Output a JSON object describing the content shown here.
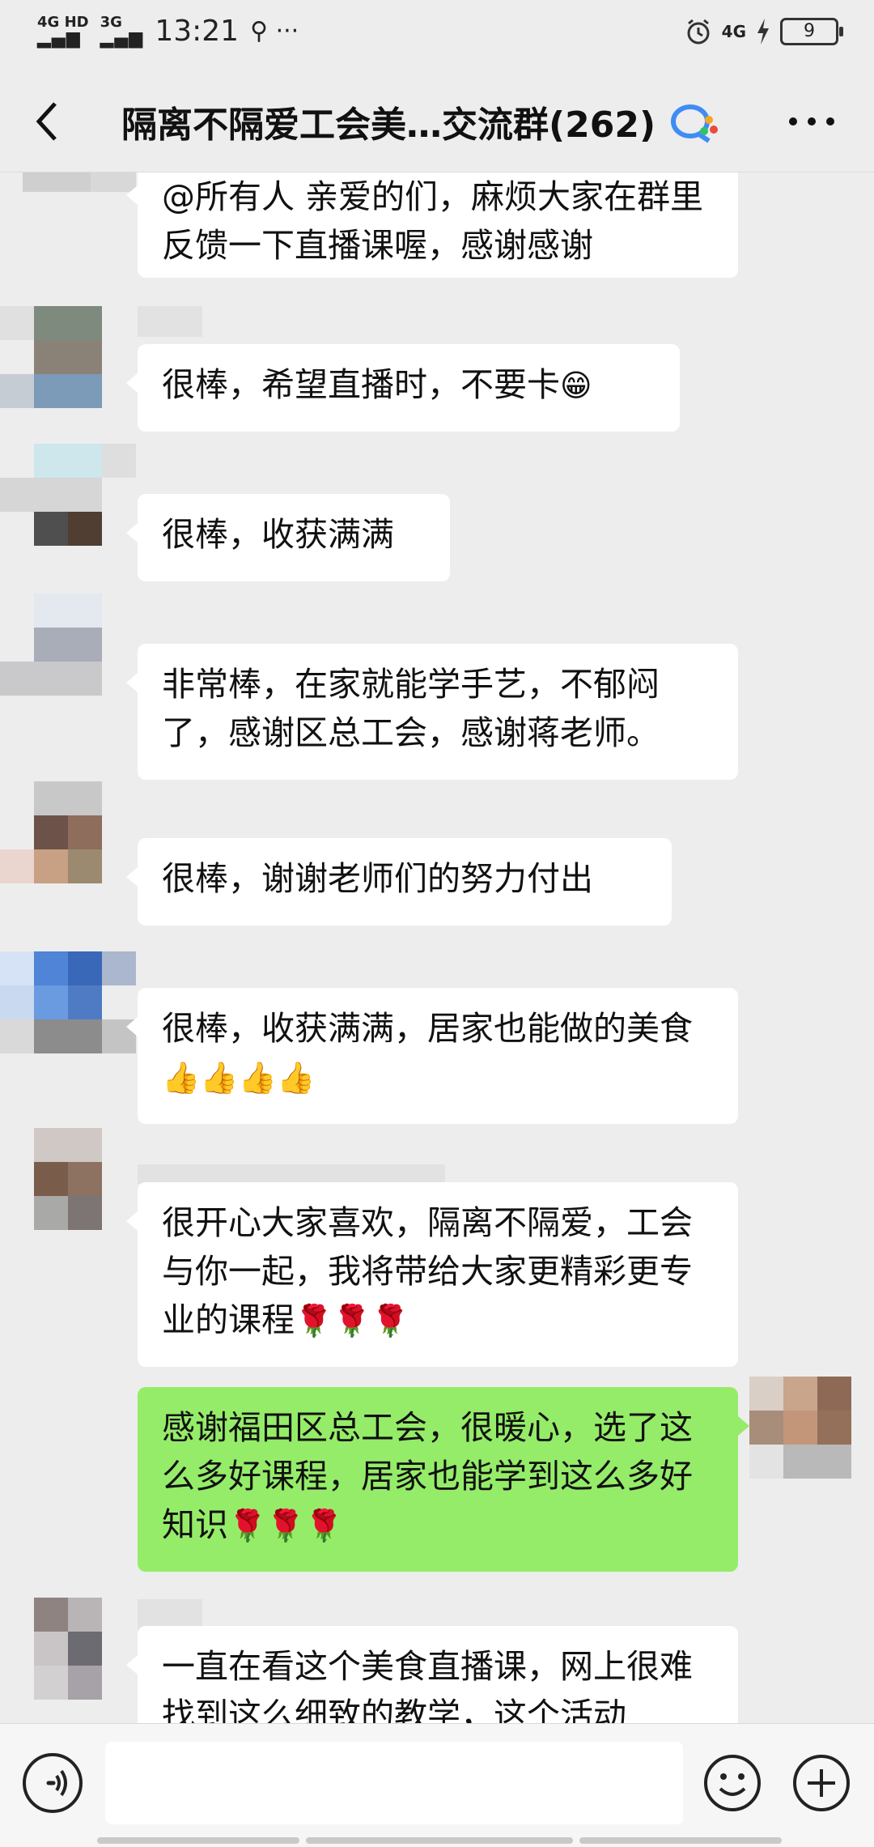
{
  "status_bar": {
    "network_1": "4G HD",
    "network_2": "3G",
    "time": "13:21",
    "extras": "⚲ ···",
    "right_network": "4G",
    "battery_level": "9"
  },
  "header": {
    "title": "隔离不隔爱工会美…交流群(262)",
    "back_icon": "chevron-left-icon",
    "more_icon": "more-dots-icon"
  },
  "messages": [
    {
      "sender": "other",
      "text": "@所有人  亲爱的们，麻烦大家在群里反馈一下直播课喔，感谢感谢"
    },
    {
      "sender": "other",
      "text": "很棒，希望直播时，不要卡",
      "emoji": "😁"
    },
    {
      "sender": "other",
      "text": "很棒，收获满满"
    },
    {
      "sender": "other",
      "text": "非常棒，在家就能学手艺，不郁闷了，感谢区总工会，感谢蒋老师。"
    },
    {
      "sender": "other",
      "text": "很棒，谢谢老师们的努力付出"
    },
    {
      "sender": "other",
      "text": "很棒，收获满满，居家也能做的美食",
      "emoji": "👍👍👍👍"
    },
    {
      "sender": "other",
      "text": "很开心大家喜欢，隔离不隔爱，工会与你一起，我将带给大家更精彩更专业的课程",
      "emoji": "🌹🌹🌹"
    },
    {
      "sender": "me",
      "text": "感谢福田区总工会，很暖心，选了这么多好课程，居家也能学到这么多好知识",
      "emoji": "🌹🌹🌹"
    },
    {
      "sender": "other",
      "text": "一直在看这个美食直播课，网上很难找到这么细致的教学，这个活动"
    }
  ],
  "input_bar": {
    "placeholder": "",
    "voice_icon": "voice-icon",
    "emoji_icon": "emoji-icon",
    "plus_icon": "plus-icon"
  },
  "colors": {
    "background": "#ededed",
    "my_bubble": "#95ec69",
    "other_bubble": "#ffffff"
  }
}
